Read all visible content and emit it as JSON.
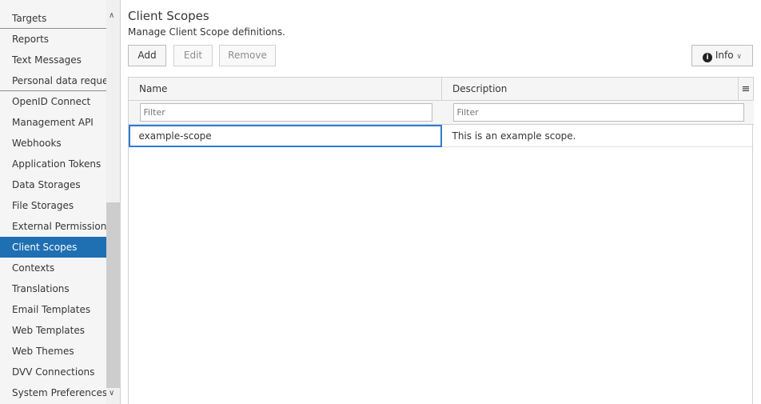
{
  "sidebar": {
    "items": [
      {
        "label": "Targets"
      },
      {
        "label": "Reports"
      },
      {
        "label": "Text Messages"
      },
      {
        "label": "Personal data requests"
      },
      {
        "label": "OpenID Connect"
      },
      {
        "label": "Management API"
      },
      {
        "label": "Webhooks"
      },
      {
        "label": "Application Tokens"
      },
      {
        "label": "Data Storages"
      },
      {
        "label": "File Storages"
      },
      {
        "label": "External Permissions"
      },
      {
        "label": "Client Scopes"
      },
      {
        "label": "Contexts"
      },
      {
        "label": "Translations"
      },
      {
        "label": "Email Templates"
      },
      {
        "label": "Web Templates"
      },
      {
        "label": "Web Themes"
      },
      {
        "label": "DVV Connections"
      },
      {
        "label": "System Preferences"
      }
    ],
    "active": "Client Scopes"
  },
  "page": {
    "title": "Client Scopes",
    "subtitle": "Manage Client Scope definitions."
  },
  "toolbar": {
    "add": "Add",
    "edit": "Edit",
    "remove": "Remove",
    "info": "Info"
  },
  "table": {
    "columns": [
      "Name",
      "Description"
    ],
    "filter_placeholder": "Filter",
    "rows": [
      {
        "name": "example-scope",
        "description": "This is an example scope."
      }
    ]
  },
  "colors": {
    "accent": "#1f6fb3"
  }
}
